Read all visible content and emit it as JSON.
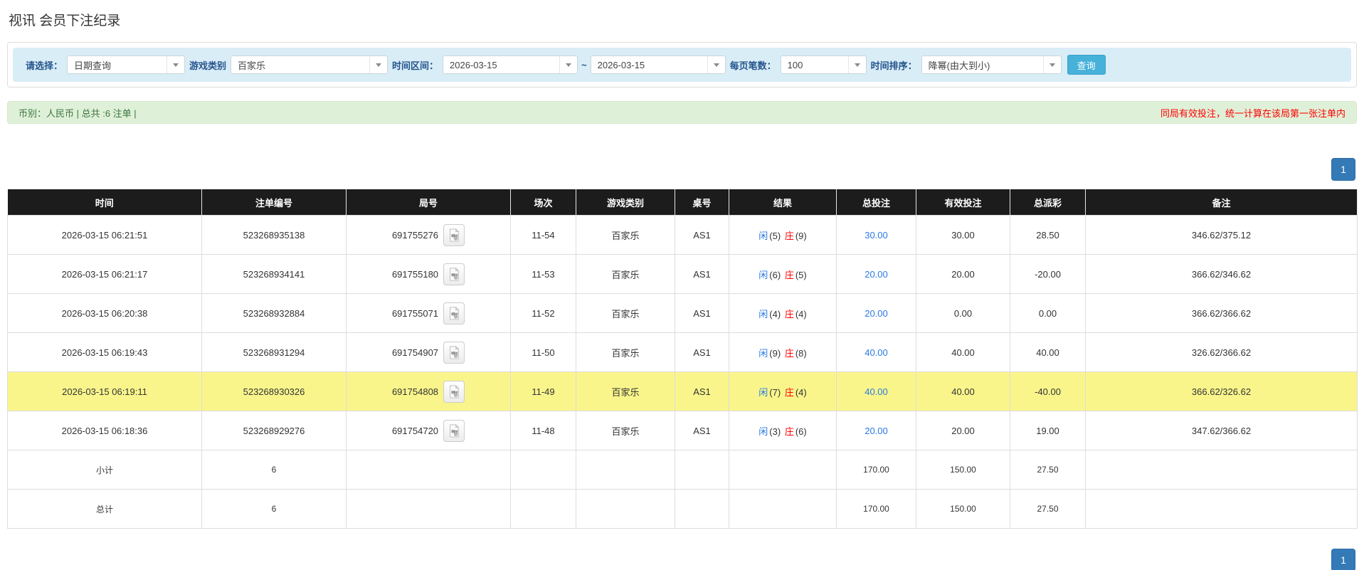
{
  "page": {
    "title": "视讯 会员下注纪录"
  },
  "colors": {
    "accent_blue": "#337ab7",
    "link_blue": "#2a7ae2",
    "danger_red": "#ff0000",
    "info_bg": "#d9edf7",
    "success_bg": "#dff0d8",
    "success_text": "#3c763d",
    "highlight_yellow": "#f9f58b",
    "header_black": "#1c1c1c",
    "summary_gray": "#9d9d9d",
    "search_button_blue": "#46b1d9"
  },
  "filters": {
    "select_label": "请选择：",
    "select_value": "日期查询",
    "game_label": "游戏类别",
    "game_value": "百家乐",
    "range_label": "时间区间：",
    "range_from": "2026-03-15",
    "range_tilde": "~",
    "range_to": "2026-03-15",
    "page_size_label": "每页笔数：",
    "page_size_value": "100",
    "sort_label": "时间排序：",
    "sort_value": "降幂(由大到小)",
    "search_button": "查询"
  },
  "info_bar": {
    "left": "币别：人民币 | 总共 :6 注单 |",
    "right": "同局有效投注，统一计算在该局第一张注单内"
  },
  "pagination": {
    "page": "1"
  },
  "icons": {
    "combo_arrow": "chevron-down-icon",
    "round_video": "video-file-icon"
  },
  "table": {
    "headers": [
      "时间",
      "注单编号",
      "局号",
      "场次",
      "游戏类别",
      "桌号",
      "结果",
      "总投注",
      "有效投注",
      "总派彩",
      "备注"
    ],
    "rows": [
      {
        "time": "2026-03-15 06:21:51",
        "bet_id": "523268935138",
        "round_id": "691755276",
        "session": "11-54",
        "game": "百家乐",
        "table_no": "AS1",
        "result_player": "闲",
        "result_player_num": "(5)",
        "result_banker": "庄",
        "result_banker_num": "(9)",
        "total_bet": "30.00",
        "valid_bet": "30.00",
        "payout": "28.50",
        "remark": "346.62/375.12"
      },
      {
        "time": "2026-03-15 06:21:17",
        "bet_id": "523268934141",
        "round_id": "691755180",
        "session": "11-53",
        "game": "百家乐",
        "table_no": "AS1",
        "result_player": "闲",
        "result_player_num": "(6)",
        "result_banker": "庄",
        "result_banker_num": "(5)",
        "total_bet": "20.00",
        "valid_bet": "20.00",
        "payout": "-20.00",
        "remark": "366.62/346.62"
      },
      {
        "time": "2026-03-15 06:20:38",
        "bet_id": "523268932884",
        "round_id": "691755071",
        "session": "11-52",
        "game": "百家乐",
        "table_no": "AS1",
        "result_player": "闲",
        "result_player_num": "(4)",
        "result_banker": "庄",
        "result_banker_num": "(4)",
        "total_bet": "20.00",
        "valid_bet": "0.00",
        "payout": "0.00",
        "remark": "366.62/366.62"
      },
      {
        "time": "2026-03-15 06:19:43",
        "bet_id": "523268931294",
        "round_id": "691754907",
        "session": "11-50",
        "game": "百家乐",
        "table_no": "AS1",
        "result_player": "闲",
        "result_player_num": "(9)",
        "result_banker": "庄",
        "result_banker_num": "(8)",
        "total_bet": "40.00",
        "valid_bet": "40.00",
        "payout": "40.00",
        "remark": "326.62/366.62"
      },
      {
        "time": "2026-03-15 06:19:11",
        "bet_id": "523268930326",
        "round_id": "691754808",
        "session": "11-49",
        "game": "百家乐",
        "table_no": "AS1",
        "result_player": "闲",
        "result_player_num": "(7)",
        "result_banker": "庄",
        "result_banker_num": "(4)",
        "total_bet": "40.00",
        "valid_bet": "40.00",
        "payout": "-40.00",
        "remark": "366.62/326.62"
      },
      {
        "time": "2026-03-15 06:18:36",
        "bet_id": "523268929276",
        "round_id": "691754720",
        "session": "11-48",
        "game": "百家乐",
        "table_no": "AS1",
        "result_player": "闲",
        "result_player_num": "(3)",
        "result_banker": "庄",
        "result_banker_num": "(6)",
        "total_bet": "20.00",
        "valid_bet": "20.00",
        "payout": "19.00",
        "remark": "347.62/366.62"
      }
    ],
    "subtotal": {
      "label": "小计",
      "count": "6",
      "total_bet": "170.00",
      "valid_bet": "150.00",
      "payout": "27.50"
    },
    "total": {
      "label": "总计",
      "count": "6",
      "total_bet": "170.00",
      "valid_bet": "150.00",
      "payout": "27.50"
    }
  }
}
